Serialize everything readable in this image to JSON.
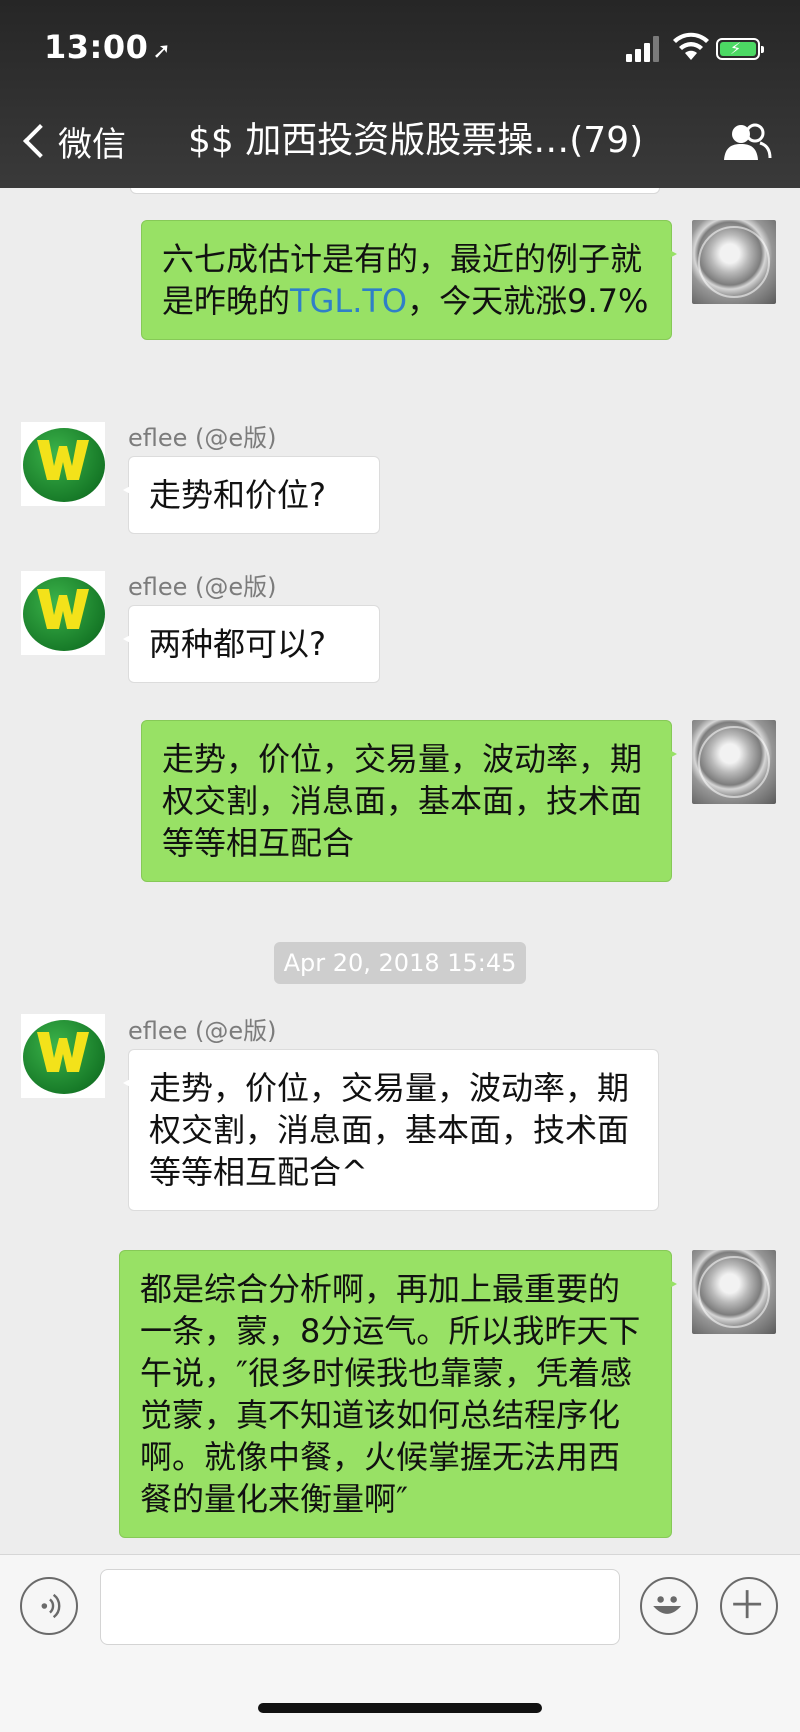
{
  "status_bar": {
    "time": "13:00",
    "location_glyph": "➚"
  },
  "nav": {
    "back_label": "微信",
    "title": "$$ 加西投资版股票操…(79)",
    "group_icon": "group-members-icon"
  },
  "messages": [
    {
      "id": "m1",
      "direction": "out",
      "parts": [
        "六七成估计是有的，最近的例子就是昨晚的",
        "TGL.TO",
        "，今天就涨9.7%"
      ]
    },
    {
      "id": "m2",
      "direction": "in",
      "sender": "eflee (@e版)",
      "text": "走势和价位?"
    },
    {
      "id": "m3",
      "direction": "in",
      "sender": "eflee (@e版)",
      "text": "两种都可以?"
    },
    {
      "id": "m4",
      "direction": "out",
      "text": "走势，价位，交易量，波动率，期权交割，消息面，基本面，技术面等等相互配合"
    },
    {
      "id": "m5",
      "direction": "in",
      "sender": "eflee (@e版)",
      "text": "走势，价位，交易量，波动率，期权交割，消息面，基本面，技术面等等相互配合^"
    },
    {
      "id": "m6",
      "direction": "out",
      "text": "都是综合分析啊，再加上最重要的一条，蒙，8分运气。所以我昨天下午说，″很多时候我也靠蒙，凭着感觉蒙，真不知道该如何总结程序化啊。就像中餐，火候掌握无法用西餐的量化来衡量啊″"
    }
  ],
  "timestamp": "Apr 20, 2018 15:45",
  "input_bar": {
    "voice_icon": "voice-icon",
    "emoji_icon": "emoji-icon",
    "plus_icon": "plus-icon",
    "input_value": ""
  },
  "colors": {
    "header": "#2d2d2d",
    "outgoing": "#98e165",
    "incoming": "#ffffff",
    "link": "#2f7fc8",
    "background": "#ededed"
  }
}
